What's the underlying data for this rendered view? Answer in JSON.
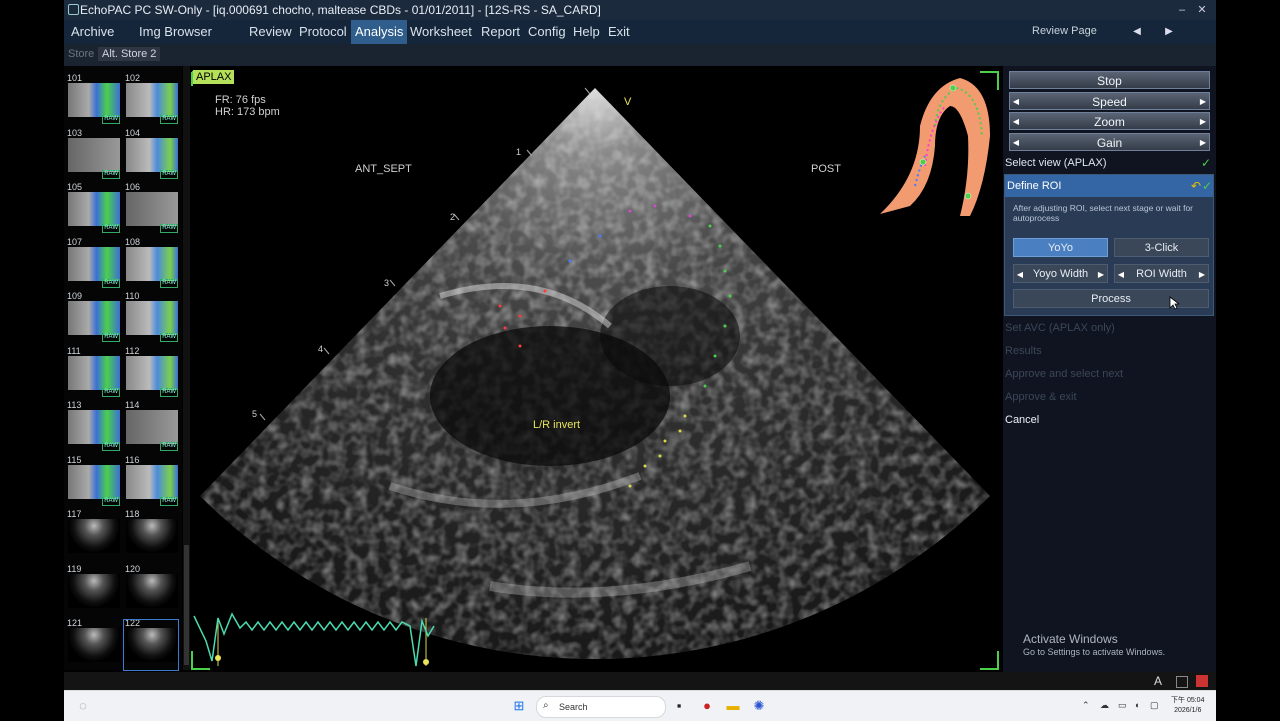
{
  "window": {
    "title": "EchoPAC PC SW-Only - [iq.000691 chocho, maltease CBDs - 01/01/2011] - [12S-RS - SA_CARD]",
    "minimize": "–",
    "close": "✕"
  },
  "menu": {
    "items": [
      "Archive",
      "Img Browser",
      "Review",
      "Protocol",
      "Analysis",
      "Worksheet",
      "Report",
      "Config",
      "Help",
      "Exit"
    ],
    "first": "Archive",
    "active": "Analysis",
    "review_page": "Review Page",
    "prev": "◀",
    "next": "▶"
  },
  "store": {
    "store_label": "Store",
    "alt_store_label": "Alt. Store 2"
  },
  "thumbnails": [
    {
      "num": "101",
      "raw": "RAW"
    },
    {
      "num": "102",
      "raw": "RAW"
    },
    {
      "num": "103",
      "raw": "RAW"
    },
    {
      "num": "104",
      "raw": "RAW"
    },
    {
      "num": "105",
      "raw": "RAW"
    },
    {
      "num": "106",
      "raw": "RAW"
    },
    {
      "num": "107",
      "raw": "RAW"
    },
    {
      "num": "108",
      "raw": "RAW"
    },
    {
      "num": "109",
      "raw": "RAW"
    },
    {
      "num": "110",
      "raw": "RAW"
    },
    {
      "num": "111",
      "raw": "RAW"
    },
    {
      "num": "112",
      "raw": "RAW"
    },
    {
      "num": "113",
      "raw": "RAW"
    },
    {
      "num": "114",
      "raw": "RAW"
    },
    {
      "num": "115",
      "raw": "RAW"
    },
    {
      "num": "116",
      "raw": "RAW"
    },
    {
      "num": "117",
      "raw": ""
    },
    {
      "num": "118",
      "raw": ""
    },
    {
      "num": "119",
      "raw": ""
    },
    {
      "num": "120",
      "raw": ""
    },
    {
      "num": "121",
      "raw": ""
    },
    {
      "num": "122",
      "raw": ""
    }
  ],
  "image": {
    "view_tag": "APLAX",
    "fr": "FR: 76 fps",
    "hr": "HR: 173 bpm",
    "ant_sept": "ANT_SEPT",
    "post": "POST",
    "apex_marker": "V",
    "lr_invert": "L/R invert",
    "depth_marks": [
      "1",
      "2",
      "3",
      "4",
      "5"
    ]
  },
  "panel": {
    "stop": "Stop",
    "speed": "Speed",
    "zoom": "Zoom",
    "gain": "Gain",
    "select_view": "Select view (APLAX)",
    "define_roi": "Define ROI",
    "roi_hint": "After adjusting ROI, select next stage or wait for autoprocess",
    "yoyo": "YoYo",
    "three_click": "3-Click",
    "yoyo_width": "Yoyo Width",
    "roi_width": "ROI Width",
    "process": "Process",
    "set_avc": "Set AVC (APLAX only)",
    "results": "Results",
    "approve_next": "Approve and select next",
    "approve_exit": "Approve & exit",
    "cancel": "Cancel",
    "check": "✓",
    "arrow_left": "◀",
    "arrow_right": "▶",
    "dim_text_color": "#3c4657",
    "check_color": "#4bd04b"
  },
  "watermark": {
    "title": "Activate Windows",
    "subtitle": "Go to Settings to activate Windows."
  },
  "taskbar": {
    "search_placeholder": "Search",
    "tray_letter": "A",
    "clock_line1": "下午 05:04",
    "clock_line2": "2026/1/6"
  }
}
